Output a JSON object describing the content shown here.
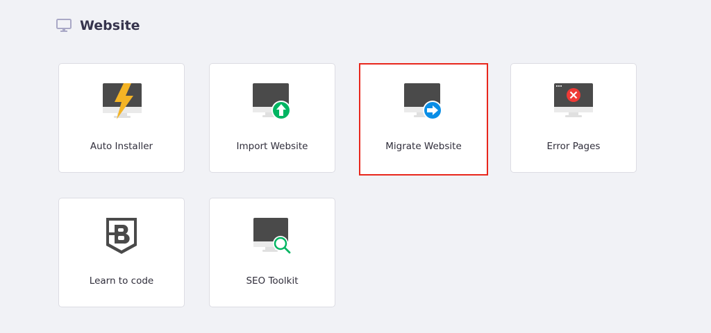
{
  "section": {
    "title": "Website",
    "icon": "monitor-icon"
  },
  "cards": [
    {
      "label": "Auto Installer",
      "icon": "lightning-monitor-icon"
    },
    {
      "label": "Import Website",
      "icon": "upload-monitor-icon",
      "accent": "#00b562"
    },
    {
      "label": "Migrate Website",
      "icon": "migrate-monitor-icon",
      "accent": "#0a8ee6",
      "highlighted": true
    },
    {
      "label": "Error Pages",
      "icon": "error-monitor-icon",
      "accent": "#ef3a36"
    },
    {
      "label": "Learn to code",
      "icon": "shield-b-icon"
    },
    {
      "label": "SEO Toolkit",
      "icon": "search-monitor-icon",
      "accent": "#00b562"
    }
  ]
}
